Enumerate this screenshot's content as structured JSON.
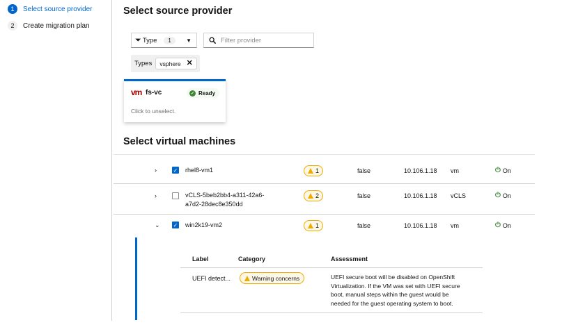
{
  "wizard": {
    "steps": [
      {
        "number": "1",
        "label": "Select source provider"
      },
      {
        "number": "2",
        "label": "Create migration plan"
      }
    ]
  },
  "provider_section": {
    "title": "Select source provider",
    "type_filter": {
      "label": "Type",
      "count": "1"
    },
    "search": {
      "placeholder": "Filter provider"
    },
    "chip_group": {
      "category": "Types",
      "chip": "vsphere"
    },
    "card": {
      "logo": "vm",
      "name": "fs-vc",
      "status": "Ready",
      "hint": "Click to unselect."
    }
  },
  "vm_section": {
    "title": "Select virtual machines",
    "rows": [
      {
        "name": "rhel8-vm1",
        "concerns": "1",
        "template": "false",
        "host": "10.106.1.18",
        "folder": "vm",
        "power": "On",
        "selected": true,
        "expanded": false
      },
      {
        "name": "vCLS-5beb2bb4-a311-42a6-a7d2-28dec8e350dd",
        "concerns": "2",
        "template": "false",
        "host": "10.106.1.18",
        "folder": "vCLS",
        "power": "On",
        "selected": false,
        "expanded": false
      },
      {
        "name": "win2k19-vm2",
        "concerns": "1",
        "template": "false",
        "host": "10.106.1.18",
        "folder": "vm",
        "power": "On",
        "selected": true,
        "expanded": true
      }
    ],
    "concerns_table": {
      "headers": {
        "label": "Label",
        "category": "Category",
        "assessment": "Assessment"
      },
      "row": {
        "label": "UEFI detect...",
        "category": "Warning concerns",
        "assessment": "UEFI secure boot will be disabled on OpenShift Virtualization. If the VM was set with UEFI secure boot, manual steps within the guest would be needed for the guest operating system to boot."
      }
    }
  },
  "colors": {
    "primary": "#0066cc",
    "success": "#3e8635",
    "warning": "#f0ab00",
    "vm_logo": "#a30000"
  }
}
